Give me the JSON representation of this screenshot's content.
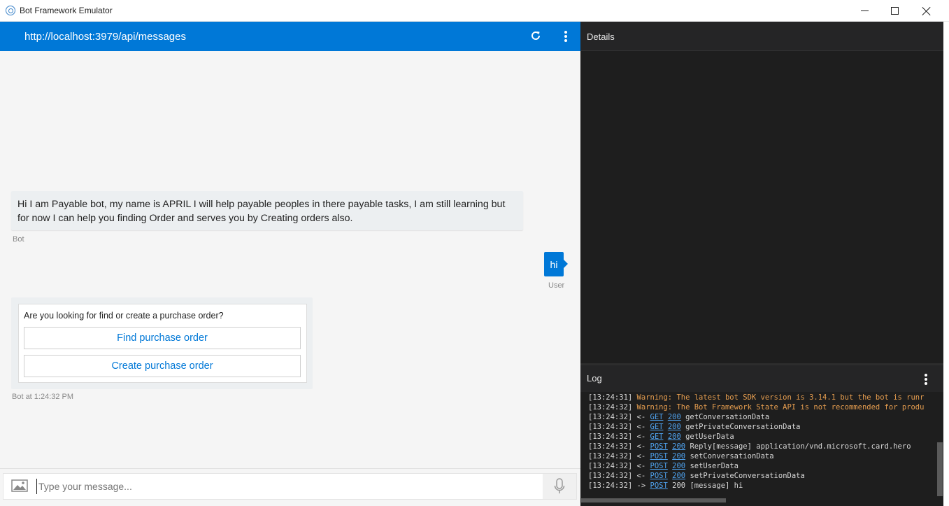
{
  "window": {
    "title": "Bot Framework Emulator"
  },
  "address_bar": {
    "url": "http://localhost:3979/api/messages",
    "icons": [
      "refresh-icon",
      "more-vertical-icon"
    ]
  },
  "chat": {
    "bot_message": "Hi I am Payable bot, my name is APRIL I will help payable peoples in there payable tasks, I am still learning but for now I can help you finding Order and serves you by Creating orders also.",
    "bot_label": "Bot",
    "user_message": "hi",
    "user_label": "User",
    "card": {
      "text": "Are you looking for find or create a purchase order?",
      "buttons": [
        "Find purchase order",
        "Create purchase order"
      ]
    },
    "card_label": "Bot at 1:24:32 PM"
  },
  "input": {
    "placeholder": "Type your message...",
    "value": ""
  },
  "details": {
    "title": "Details"
  },
  "log": {
    "title": "Log",
    "lines": [
      {
        "time": "[13:24:31]",
        "kind": "warning",
        "text": "Warning: The latest bot SDK version is 3.14.1 but the bot is runr"
      },
      {
        "time": "[13:24:32]",
        "kind": "warning",
        "text": "Warning: The Bot Framework State API is not recommended for produ"
      },
      {
        "time": "[13:24:32]",
        "kind": "request",
        "dir": "<-",
        "method": "GET",
        "status": "200",
        "text": "getConversationData"
      },
      {
        "time": "[13:24:32]",
        "kind": "request",
        "dir": "<-",
        "method": "GET",
        "status": "200",
        "text": "getPrivateConversationData"
      },
      {
        "time": "[13:24:32]",
        "kind": "request",
        "dir": "<-",
        "method": "GET",
        "status": "200",
        "text": "getUserData"
      },
      {
        "time": "[13:24:32]",
        "kind": "request",
        "dir": "<-",
        "method": "POST",
        "status": "200",
        "text": "Reply[message] application/vnd.microsoft.card.hero"
      },
      {
        "time": "[13:24:32]",
        "kind": "request",
        "dir": "<-",
        "method": "POST",
        "status": "200",
        "text": "setConversationData"
      },
      {
        "time": "[13:24:32]",
        "kind": "request",
        "dir": "<-",
        "method": "POST",
        "status": "200",
        "text": "setUserData"
      },
      {
        "time": "[13:24:32]",
        "kind": "request",
        "dir": "<-",
        "method": "POST",
        "status": "200",
        "text": "setPrivateConversationData"
      },
      {
        "time": "[13:24:32]",
        "kind": "outgoing",
        "dir": "->",
        "method": "POST",
        "status": "200",
        "text": "[message] hi"
      }
    ]
  },
  "colors": {
    "accent": "#0078d7",
    "warning": "#e59d4f",
    "link": "#4fa3f0",
    "panel_bg": "#1e1e1e"
  }
}
